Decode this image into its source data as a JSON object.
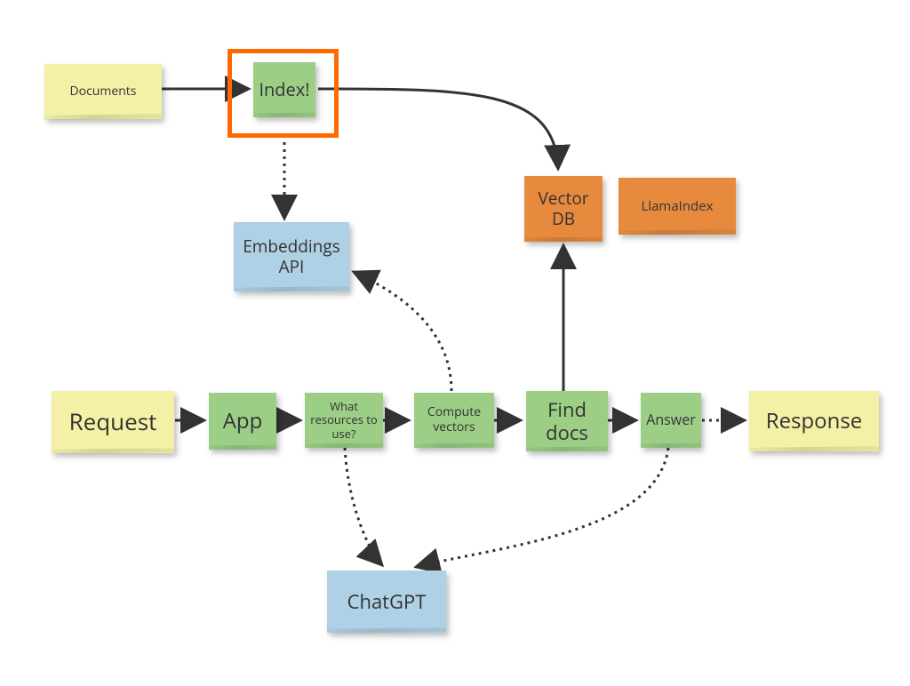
{
  "nodes": {
    "documents": {
      "label": "Documents"
    },
    "index": {
      "label": "Index!"
    },
    "embeddings": {
      "label": "Embeddings API"
    },
    "vectordb": {
      "label": "Vector DB"
    },
    "llamaindex": {
      "label": "LlamaIndex"
    },
    "request": {
      "label": "Request"
    },
    "app": {
      "label": "App"
    },
    "resources": {
      "label": "What resources to use?"
    },
    "compute": {
      "label": "Compute vectors"
    },
    "finddocs": {
      "label": "Find docs"
    },
    "answer": {
      "label": "Answer"
    },
    "response": {
      "label": "Response"
    },
    "chatgpt": {
      "label": "ChatGPT"
    }
  },
  "colors": {
    "yellow": "#f4f0a6",
    "green": "#9cce86",
    "blue": "#aed1e6",
    "orange": "#e78a3e",
    "highlight": "#ff6a00",
    "arrow": "#333333"
  },
  "edges": [
    {
      "from": "documents",
      "to": "index",
      "style": "solid"
    },
    {
      "from": "index",
      "to": "vectordb",
      "style": "solid"
    },
    {
      "from": "index",
      "to": "embeddings",
      "style": "dotted"
    },
    {
      "from": "request",
      "to": "app",
      "style": "solid"
    },
    {
      "from": "app",
      "to": "resources",
      "style": "solid"
    },
    {
      "from": "resources",
      "to": "compute",
      "style": "solid"
    },
    {
      "from": "compute",
      "to": "finddocs",
      "style": "solid"
    },
    {
      "from": "finddocs",
      "to": "answer",
      "style": "solid"
    },
    {
      "from": "answer",
      "to": "response",
      "style": "dotted"
    },
    {
      "from": "finddocs",
      "to": "vectordb",
      "style": "solid"
    },
    {
      "from": "compute",
      "to": "embeddings",
      "style": "dotted"
    },
    {
      "from": "resources",
      "to": "chatgpt",
      "style": "dotted"
    },
    {
      "from": "answer",
      "to": "chatgpt",
      "style": "dotted"
    }
  ]
}
